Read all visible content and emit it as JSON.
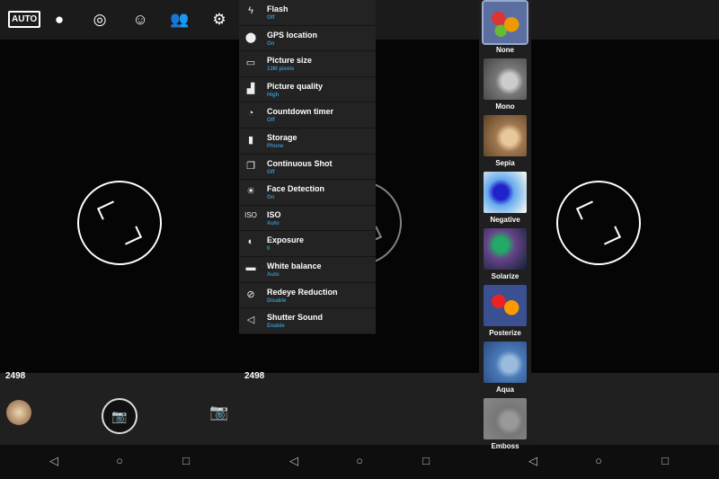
{
  "top_icons": {
    "auto_label": "AUTO",
    "icons": [
      "color-effects-icon",
      "switch-camera-icon",
      "scene-mode-icon",
      "face-beauty-icon",
      "settings-icon"
    ]
  },
  "remaining_shots": "2498",
  "settings_menu": [
    {
      "title": "Flash",
      "value": "Off",
      "icon": "flash-icon"
    },
    {
      "title": "GPS location",
      "value": "On",
      "icon": "location-icon"
    },
    {
      "title": "Picture size",
      "value": "13M pixels",
      "icon": "picture-size-icon"
    },
    {
      "title": "Picture quality",
      "value": "High",
      "icon": "quality-icon"
    },
    {
      "title": "Countdown timer",
      "value": "Off",
      "icon": "timer-icon"
    },
    {
      "title": "Storage",
      "value": "Phone",
      "icon": "storage-icon"
    },
    {
      "title": "Continuous Shot",
      "value": "Off",
      "icon": "continuous-shot-icon"
    },
    {
      "title": "Face Detection",
      "value": "On",
      "icon": "face-detection-icon"
    },
    {
      "title": "ISO",
      "value": "Auto",
      "icon": "iso-icon"
    },
    {
      "title": "Exposure",
      "value": "0",
      "icon": "exposure-icon"
    },
    {
      "title": "White balance",
      "value": "Auto",
      "icon": "white-balance-icon"
    },
    {
      "title": "Redeye Reduction",
      "value": "Disable",
      "icon": "redeye-icon"
    },
    {
      "title": "Shutter Sound",
      "value": "Enable",
      "icon": "sound-icon"
    }
  ],
  "filters": [
    "None",
    "Mono",
    "Sepia",
    "Negative",
    "Solarize",
    "Posterize",
    "Aqua",
    "Emboss"
  ],
  "selected_filter": "None",
  "colors": {
    "accent": "#3a8fbf",
    "menu_bg": "#232323"
  }
}
